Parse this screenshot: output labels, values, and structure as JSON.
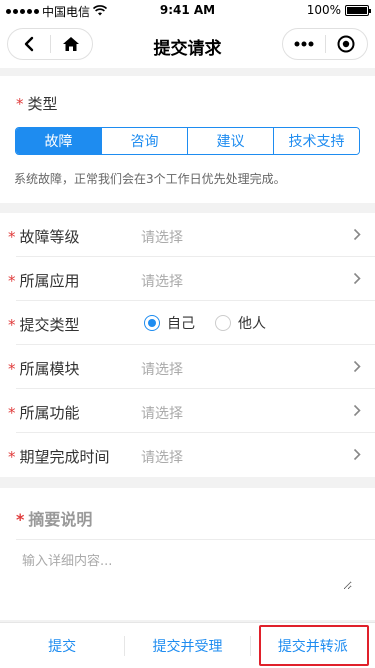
{
  "status_bar": {
    "carrier": "中国电信",
    "time": "9:41 AM",
    "battery": "100%"
  },
  "nav": {
    "title": "提交请求",
    "back_icon": "chevron-left-icon",
    "home_icon": "home-icon",
    "more_icon": "more-dots-icon",
    "close_icon": "target-circle-icon"
  },
  "type_section": {
    "label": "类型",
    "required_mark": "*",
    "options": [
      "故障",
      "咨询",
      "建议",
      "技术支持"
    ],
    "selected": "故障",
    "hint": "系统故障，正常我们会在3个工作日优先处理完成。"
  },
  "fields": [
    {
      "label": "故障等级",
      "value": "请选择"
    },
    {
      "label": "所属应用",
      "value": "请选择"
    },
    {
      "label": "提交类型",
      "options": [
        "自己",
        "他人"
      ],
      "selected": "自己"
    },
    {
      "label": "所属模块",
      "value": "请选择"
    },
    {
      "label": "所属功能",
      "value": "请选择"
    },
    {
      "label": "期望完成时间",
      "value": "请选择"
    }
  ],
  "summary": {
    "title": "摘要说明",
    "placeholder": "输入详细内容..."
  },
  "actions": {
    "submit": "提交",
    "submit_accept": "提交并受理",
    "submit_transfer": "提交并转派"
  },
  "colors": {
    "accent": "#1e8cf0",
    "required": "#e03c3c",
    "highlight_box": "#e0202a"
  }
}
